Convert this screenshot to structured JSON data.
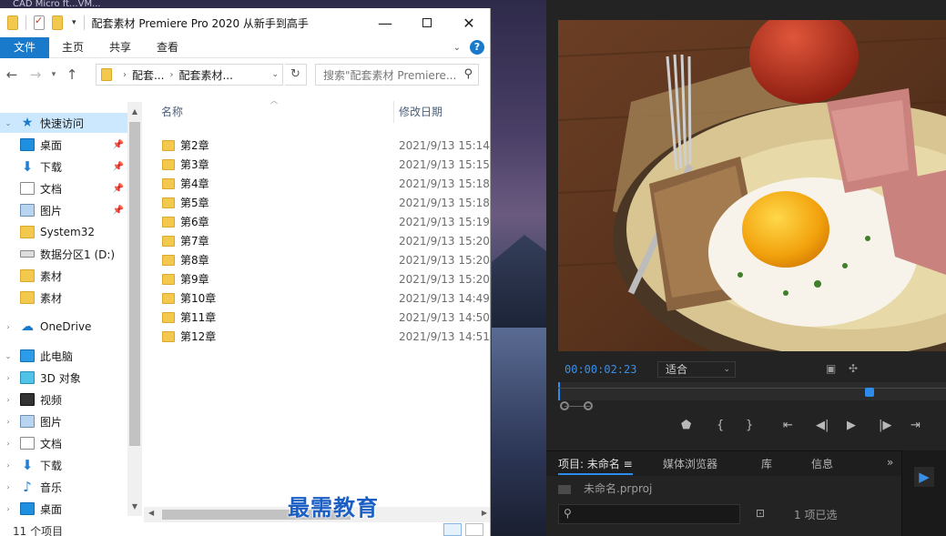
{
  "desktop": {
    "title_fragment": "CAD    Micro    ft...VM..."
  },
  "explorer": {
    "title": "配套素材 Premiere Pro 2020 从新手到高手",
    "ribbon": {
      "tabs": [
        "文件",
        "主页",
        "共享",
        "查看"
      ]
    },
    "address": {
      "crumbs": [
        "配套...",
        "配套素材..."
      ]
    },
    "search": {
      "placeholder": "搜索\"配套素材 Premiere..."
    },
    "nav": {
      "quick_access": "快速访问",
      "items": [
        {
          "label": "桌面",
          "icon": "desktop-icon",
          "pinned": true
        },
        {
          "label": "下载",
          "icon": "download-icon",
          "pinned": true
        },
        {
          "label": "文档",
          "icon": "document-icon",
          "pinned": true
        },
        {
          "label": "图片",
          "icon": "picture-icon",
          "pinned": true
        },
        {
          "label": "System32",
          "icon": "folder-icon",
          "pinned": false
        },
        {
          "label": "数据分区1 (D:)",
          "icon": "drive-icon",
          "pinned": false
        },
        {
          "label": "素材",
          "icon": "folder-icon",
          "pinned": false
        },
        {
          "label": "素材",
          "icon": "folder-icon",
          "pinned": false
        }
      ],
      "onedrive": "OneDrive",
      "this_pc": "此电脑",
      "pc_items": [
        {
          "label": "3D 对象",
          "icon": "3d-objects-icon"
        },
        {
          "label": "视频",
          "icon": "video-icon"
        },
        {
          "label": "图片",
          "icon": "picture-icon"
        },
        {
          "label": "文档",
          "icon": "document-icon"
        },
        {
          "label": "下载",
          "icon": "download-icon"
        },
        {
          "label": "音乐",
          "icon": "music-icon"
        },
        {
          "label": "桌面",
          "icon": "desktop-icon"
        }
      ]
    },
    "columns": {
      "name": "名称",
      "date": "修改日期"
    },
    "files": [
      {
        "name": "第2章",
        "date": "2021/9/13 15:14"
      },
      {
        "name": "第3章",
        "date": "2021/9/13 15:15"
      },
      {
        "name": "第4章",
        "date": "2021/9/13 15:18"
      },
      {
        "name": "第5章",
        "date": "2021/9/13 15:18"
      },
      {
        "name": "第6章",
        "date": "2021/9/13 15:19"
      },
      {
        "name": "第7章",
        "date": "2021/9/13 15:20"
      },
      {
        "name": "第8章",
        "date": "2021/9/13 15:20"
      },
      {
        "name": "第9章",
        "date": "2021/9/13 15:20"
      },
      {
        "name": "第10章",
        "date": "2021/9/13 14:49"
      },
      {
        "name": "第11章",
        "date": "2021/9/13 14:50"
      },
      {
        "name": "第12章",
        "date": "2021/9/13 14:51"
      }
    ],
    "status": {
      "count": "11 个项目"
    }
  },
  "premiere": {
    "timecode": "00:00:02:23",
    "fit": "适合",
    "tabs": [
      "项目: 未命名",
      "媒体浏览器",
      "库",
      "信息"
    ],
    "project_file": "未命名.prproj",
    "item_count": "1 项已选",
    "more": "»"
  },
  "watermark": "最需教育"
}
